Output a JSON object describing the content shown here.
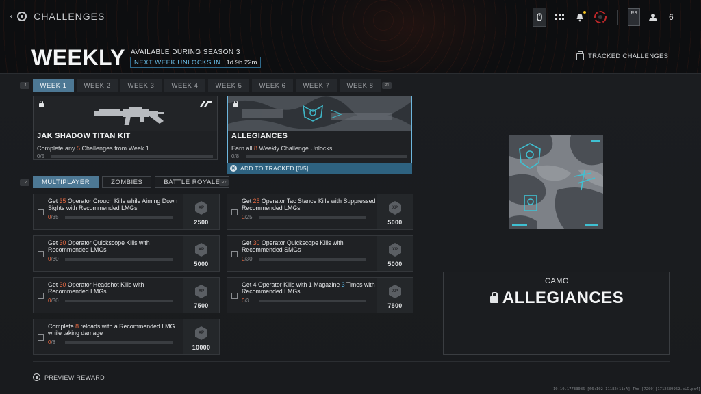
{
  "header": {
    "breadcrumb": "CHALLENGES",
    "title": "WEEKLY",
    "availability": "AVAILABLE DURING SEASON 3",
    "next_unlock_label": "NEXT WEEK UNLOCKS IN",
    "next_unlock_time": "1d 9h 22m",
    "tracked_label": "TRACKED CHALLENGES",
    "player_count": "6",
    "r3_label": "R3"
  },
  "week_tabs": [
    "WEEK 1",
    "WEEK 2",
    "WEEK 3",
    "WEEK 4",
    "WEEK 5",
    "WEEK 6",
    "WEEK 7",
    "WEEK 8"
  ],
  "active_week": 0,
  "bumpers": {
    "left": "L1",
    "right": "R1",
    "mode_left": "L2",
    "mode_right": "R2"
  },
  "rewards": [
    {
      "name": "JAK SHADOW TITAN KIT",
      "desc_pre": "Complete any ",
      "desc_num": "5",
      "desc_post": " Challenges from Week 1",
      "progress": "0/5",
      "progress_fraction": 0
    },
    {
      "name": "ALLEGIANCES",
      "desc_pre": "Earn all ",
      "desc_num": "8",
      "desc_post": " Weekly Challenge Unlocks",
      "progress": "0/8",
      "progress_fraction": 0,
      "track_label": "ADD TO TRACKED [0/5]"
    }
  ],
  "mode_tabs": [
    "MULTIPLAYER",
    "ZOMBIES",
    "BATTLE ROYALE"
  ],
  "active_mode": 0,
  "challenges": [
    {
      "pre": "Get ",
      "num": "35",
      "post": " Operator Crouch Kills while Aiming Down Sights with Recommended LMGs",
      "done": "0",
      "total": "/35",
      "xp": "2500",
      "xp_badge": "XP"
    },
    {
      "pre": "Get ",
      "num": "25",
      "post": " Operator Tac Stance Kills with Suppressed Recommended LMGs",
      "done": "0",
      "total": "/25",
      "xp": "5000",
      "xp_badge": "XP"
    },
    {
      "pre": "Get ",
      "num": "30",
      "post": " Operator Quickscope Kills with Recommended LMGs",
      "done": "0",
      "total": "/30",
      "xp": "5000",
      "xp_badge": "XP"
    },
    {
      "pre": "Get ",
      "num": "30",
      "post": " Operator Quickscope Kills with Recommended SMGs",
      "done": "0",
      "total": "/30",
      "xp": "5000",
      "xp_badge": "XP"
    },
    {
      "pre": "Get ",
      "num": "30",
      "post": " Operator Headshot Kills with Recommended LMGs",
      "done": "0",
      "total": "/30",
      "xp": "7500",
      "xp_badge": "XP"
    },
    {
      "pre": "Get 4 Operator Kills with 1 Magazine ",
      "num": "3",
      "post": " Times with Recommended LMGs",
      "done": "0",
      "total": "/3",
      "xp": "7500",
      "xp_badge": "XP",
      "num_color": "blue"
    },
    {
      "pre": "Complete ",
      "num": "8",
      "post": " reloads with a Recommended LMG while taking damage",
      "done": "0",
      "total": "/8",
      "xp": "10000",
      "xp_badge": "XP"
    }
  ],
  "preview": {
    "type": "CAMO",
    "name": "ALLEGIANCES",
    "preview_label": "PREVIEW REWARD"
  },
  "build_info": "10.10.17733086 [66:102:11182+11:A] Tho [7200][1712689962.pLG.ps4]",
  "colors": {
    "accent": "#4d7894",
    "highlight_orange": "#ea6a42",
    "highlight_blue": "#58b6e6",
    "selected_border": "#6db6dd"
  }
}
